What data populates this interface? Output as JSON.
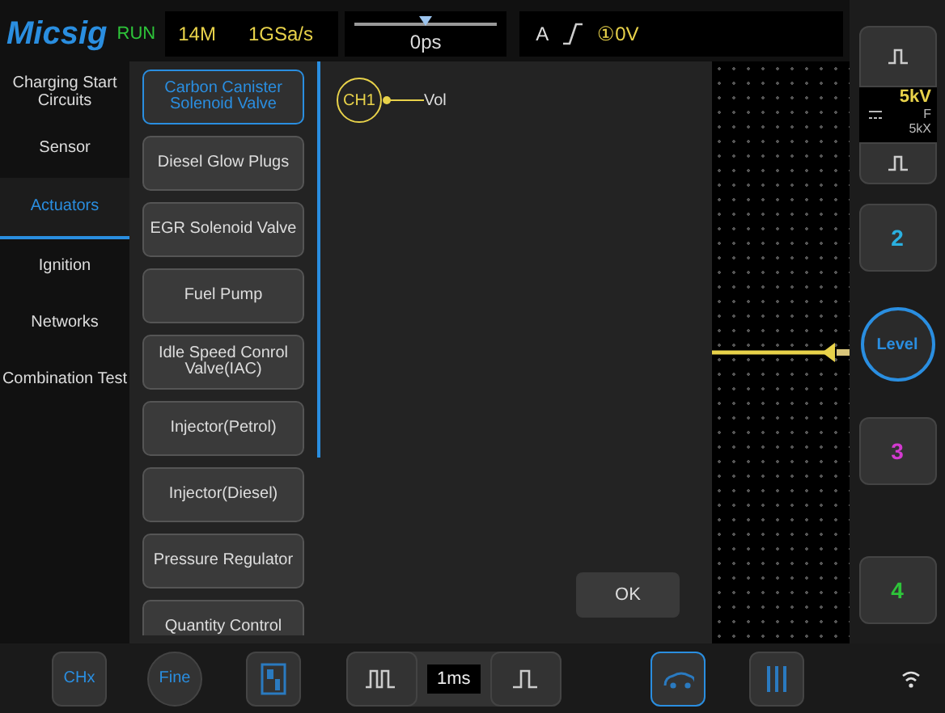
{
  "header": {
    "logo": "Micsig",
    "run_state": "RUN",
    "memory_depth": "14M",
    "sample_rate": "1GSa/s",
    "time_offset": "0ps",
    "trigger_source": "A",
    "trigger_level": "①0V"
  },
  "categories": [
    {
      "label": "Charging Start Circuits",
      "selected": false
    },
    {
      "label": "Sensor",
      "selected": false
    },
    {
      "label": "Actuators",
      "selected": true
    },
    {
      "label": "Ignition",
      "selected": false
    },
    {
      "label": "Networks",
      "selected": false
    },
    {
      "label": "Combination Test",
      "selected": false
    }
  ],
  "test_items": [
    {
      "label": "Carbon Canister Solenoid Valve",
      "selected": true
    },
    {
      "label": "Diesel Glow Plugs",
      "selected": false
    },
    {
      "label": "EGR Solenoid Valve",
      "selected": false
    },
    {
      "label": "Fuel Pump",
      "selected": false
    },
    {
      "label": "Idle Speed Conrol Valve(IAC)",
      "selected": false
    },
    {
      "label": "Injector(Petrol)",
      "selected": false
    },
    {
      "label": "Injector(Diesel)",
      "selected": false
    },
    {
      "label": "Pressure Regulator",
      "selected": false
    },
    {
      "label": "Quantity Control",
      "selected": false
    }
  ],
  "probe": {
    "channel": "CH1",
    "label": "Vol"
  },
  "ok_button": "OK",
  "right_panel": {
    "ch1_scale": "5kV",
    "coupling": "F",
    "probe_ratio": "5kX",
    "level_button": "Level",
    "channels": [
      {
        "label": "2",
        "color": "#2ab0e0"
      },
      {
        "label": "3",
        "color": "#d33ad0"
      },
      {
        "label": "4",
        "color": "#2ec43a"
      }
    ]
  },
  "bottom": {
    "chx": "CHx",
    "fine": "Fine",
    "timebase": "1ms"
  }
}
